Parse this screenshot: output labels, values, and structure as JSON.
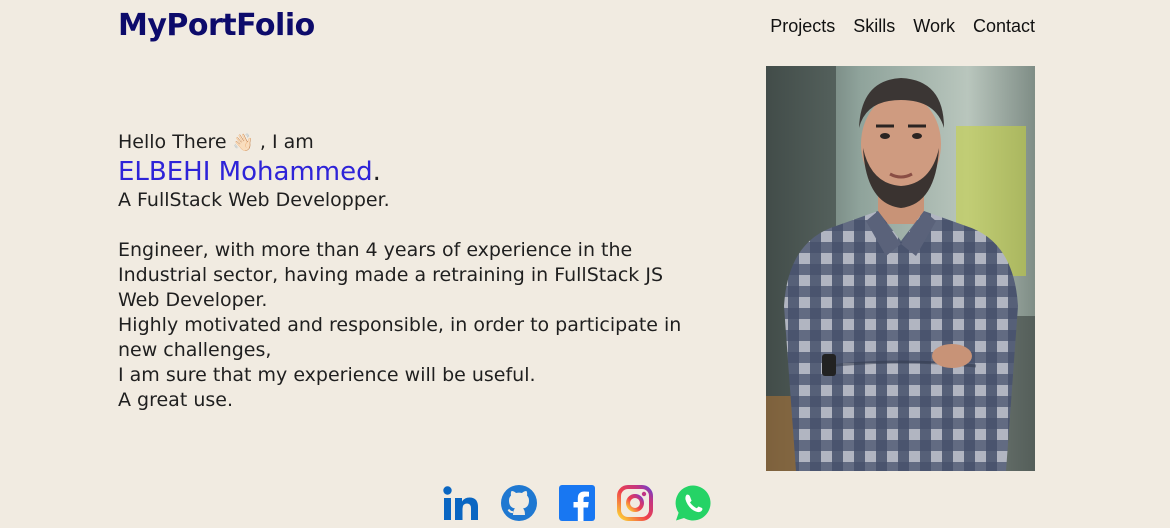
{
  "header": {
    "logo": "MyPortFolio",
    "nav": [
      {
        "label": "Projects"
      },
      {
        "label": "Skills"
      },
      {
        "label": "Work"
      },
      {
        "label": "Contact"
      }
    ]
  },
  "intro": {
    "greeting_pre": "Hello There",
    "wave_emoji": "👋🏻",
    "greeting_post": ", I am",
    "name": "ELBEHI Mohammed",
    "name_suffix": ".",
    "role": "A FullStack Web Developper.",
    "bio_lines": [
      "Engineer, with more than 4 years of experience in the",
      "Industrial sector, having made a retraining in FullStack JS",
      "Web Developer.",
      "Highly motivated and responsible, in order to participate in",
      "new challenges,",
      "I am sure that my experience will be useful.",
      "A great use."
    ]
  },
  "photo": {
    "subject": "profile-photo"
  },
  "socials": [
    {
      "icon": "linkedin-icon",
      "color": "#0a66c2"
    },
    {
      "icon": "github-icon",
      "color": "#1f78d1"
    },
    {
      "icon": "facebook-icon",
      "color": "#1877f2"
    },
    {
      "icon": "instagram-icon",
      "color": "#e1306c"
    },
    {
      "icon": "whatsapp-icon",
      "color": "#25d366"
    }
  ],
  "colors": {
    "background": "#f1ebe1",
    "logo": "#0d0b6b",
    "name_accent": "#2e23d8"
  }
}
